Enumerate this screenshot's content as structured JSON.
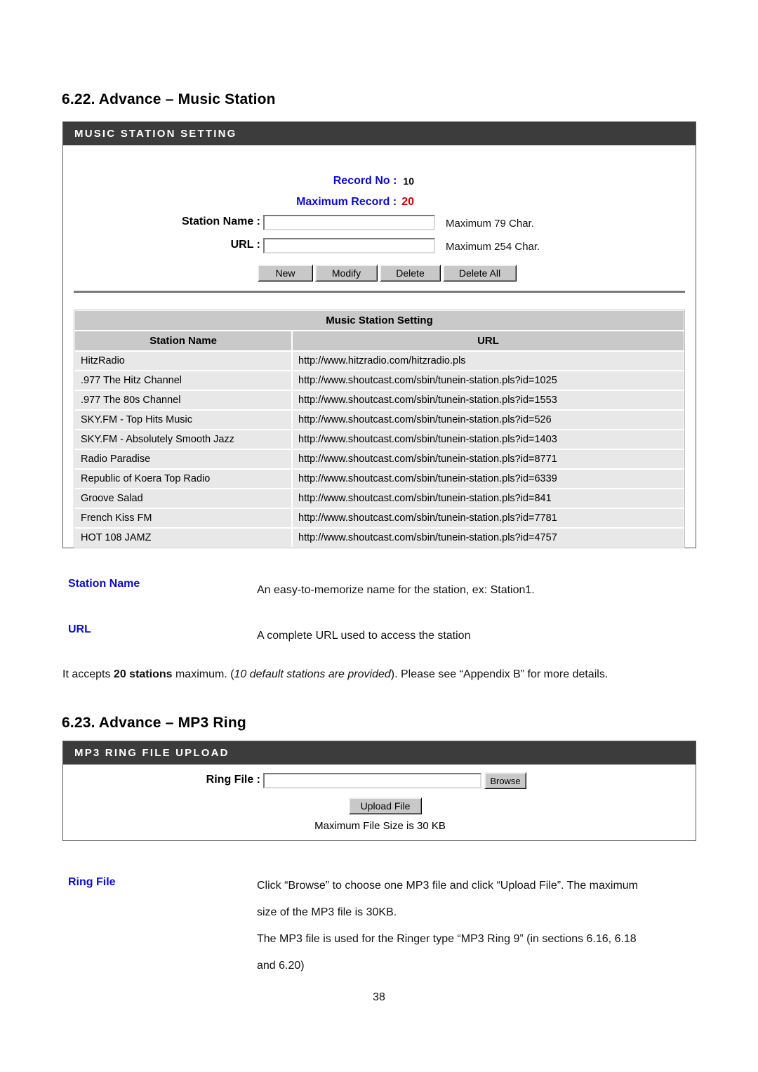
{
  "document": {
    "page_number": "38"
  },
  "sections": [
    {
      "number": "6.22.",
      "title": "Advance – Music Station"
    },
    {
      "number": "6.23.",
      "title": "Advance – MP3 Ring"
    }
  ],
  "music_station_panel": {
    "title": "MUSIC STATION SETTING",
    "record_no_label": "Record No :",
    "record_no_value": "10",
    "maximum_record_label": "Maximum Record :",
    "maximum_record_value": "20",
    "station_name_label": "Station Name :",
    "station_name_value": "",
    "station_name_hint": "Maximum 79 Char.",
    "url_label": "URL :",
    "url_value": "",
    "url_hint": "Maximum 254 Char.",
    "buttons": [
      {
        "label": "New"
      },
      {
        "label": "Modify"
      },
      {
        "label": "Delete"
      },
      {
        "label": "Delete All"
      }
    ],
    "table": {
      "caption": "Music Station Setting",
      "headers": [
        "Station Name",
        "URL"
      ],
      "rows": [
        [
          "HitzRadio",
          "http://www.hitzradio.com/hitzradio.pls"
        ],
        [
          ".977 The Hitz Channel",
          "http://www.shoutcast.com/sbin/tunein-station.pls?id=1025"
        ],
        [
          ".977 The 80s Channel",
          "http://www.shoutcast.com/sbin/tunein-station.pls?id=1553"
        ],
        [
          "SKY.FM - Top Hits Music",
          "http://www.shoutcast.com/sbin/tunein-station.pls?id=526"
        ],
        [
          "SKY.FM - Absolutely Smooth Jazz",
          "http://www.shoutcast.com/sbin/tunein-station.pls?id=1403"
        ],
        [
          "Radio Paradise",
          "http://www.shoutcast.com/sbin/tunein-station.pls?id=8771"
        ],
        [
          "Republic of Koera Top Radio",
          "http://www.shoutcast.com/sbin/tunein-station.pls?id=6339"
        ],
        [
          "Groove Salad",
          "http://www.shoutcast.com/sbin/tunein-station.pls?id=841"
        ],
        [
          "French Kiss FM",
          "http://www.shoutcast.com/sbin/tunein-station.pls?id=7781"
        ],
        [
          "HOT 108 JAMZ",
          "http://www.shoutcast.com/sbin/tunein-station.pls?id=4757"
        ]
      ]
    }
  },
  "music_station_definitions": [
    {
      "term": "Station Name",
      "description": "An easy-to-memorize name for the station, ex: Station1."
    },
    {
      "term": "URL",
      "description": "A complete URL used to access the station"
    }
  ],
  "music_station_note": {
    "part1": "It accepts ",
    "bold1": "20 stations",
    "part2": " maximum. (",
    "italic1": "10 default stations are provided",
    "part3": "). Please see “Appendix B” for more details."
  },
  "mp3_ring_panel": {
    "title": "MP3 RING FILE UPLOAD",
    "ring_file_label": "Ring File :",
    "ring_file_value": "",
    "browse_button": "Browse",
    "upload_button": "Upload File",
    "max_size_note": "Maximum File Size is 30 KB"
  },
  "mp3_ring_definition": {
    "term": "Ring File",
    "line1": "Click “Browse” to choose one MP3 file and click “Upload File”. The maximum",
    "line2": "size of the MP3 file is 30KB.",
    "line3": "The MP3 file is used for the Ringer type “MP3 Ring 9” (in sections 6.16, 6.18",
    "line4": "and 6.20)"
  },
  "colors": {
    "panel_header_bg": "#3c3c3c",
    "label_blue": "#0b0bc8",
    "value_red": "#d40000",
    "table_header_bg": "#c9c9c9",
    "table_cell_bg": "#e8e8e8"
  }
}
